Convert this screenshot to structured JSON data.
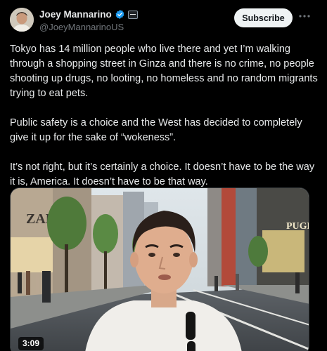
{
  "author": {
    "name": "Joey Mannarino",
    "handle": "@JoeyMannarinoUS"
  },
  "subscribe_label": "Subscribe",
  "post": {
    "paragraphs": [
      "Tokyo has 14 million people who live there and yet I’m walking through a shopping street in Ginza and there is no crime, no people shooting up drugs, no looting, no homeless and no random migrants trying to eat pets.",
      "Public safety is a choice and the West has decided to completely give it up for the sake of “wokeness”.",
      "It’s not right, but it’s certainly a choice. It doesn’t have to be the way it is, America. It doesn’t have to be that way."
    ]
  },
  "video": {
    "duration": "3:09",
    "sign_left": "ZARA",
    "sign_right": "PUGET"
  },
  "icons": {
    "verified": "verified-badge-icon",
    "affiliation": "affiliation-badge-icon",
    "more": "more-options-icon"
  },
  "colors": {
    "background": "#000000",
    "text": "#e7e9ea",
    "secondary_text": "#71767b",
    "verified_blue": "#1d9bf0",
    "subscribe_bg": "#eff3f4"
  }
}
